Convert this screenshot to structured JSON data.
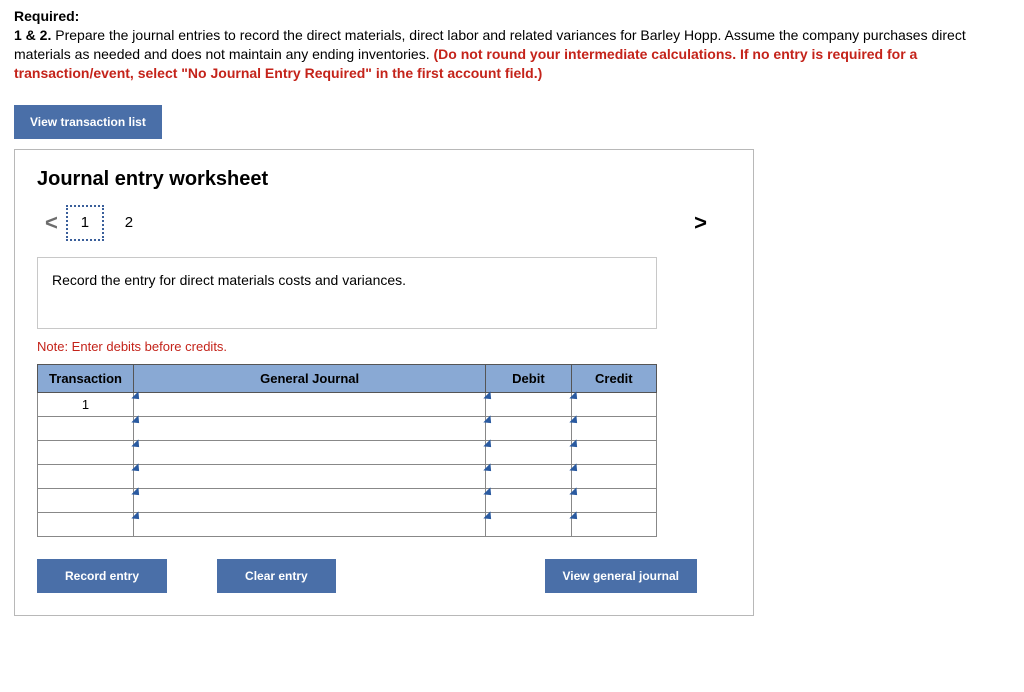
{
  "header": {
    "required_label": "Required:",
    "item_num": "1 & 2.",
    "text_plain": " Prepare the journal entries to record the direct materials, direct labor and related variances for Barley Hopp. Assume the company purchases direct materials as needed and does not maintain any ending inventories. ",
    "text_red": "(Do not round your intermediate calculations. If no entry is required for a transaction/event, select \"No Journal Entry Required\" in the first account field.)"
  },
  "buttons": {
    "view_list": "View transaction list",
    "record_entry": "Record entry",
    "clear_entry": "Clear entry",
    "view_general": "View general journal"
  },
  "worksheet": {
    "title": "Journal entry worksheet",
    "pager": {
      "prev": "<",
      "next": ">",
      "pages": [
        "1",
        "2"
      ],
      "active": "1"
    },
    "instruction": "Record the entry for direct materials costs and variances.",
    "note": "Note: Enter debits before credits.",
    "columns": {
      "transaction": "Transaction",
      "general_journal": "General Journal",
      "debit": "Debit",
      "credit": "Credit"
    },
    "rows": [
      {
        "transaction": "1"
      },
      {
        "transaction": ""
      },
      {
        "transaction": ""
      },
      {
        "transaction": ""
      },
      {
        "transaction": ""
      },
      {
        "transaction": ""
      }
    ]
  }
}
